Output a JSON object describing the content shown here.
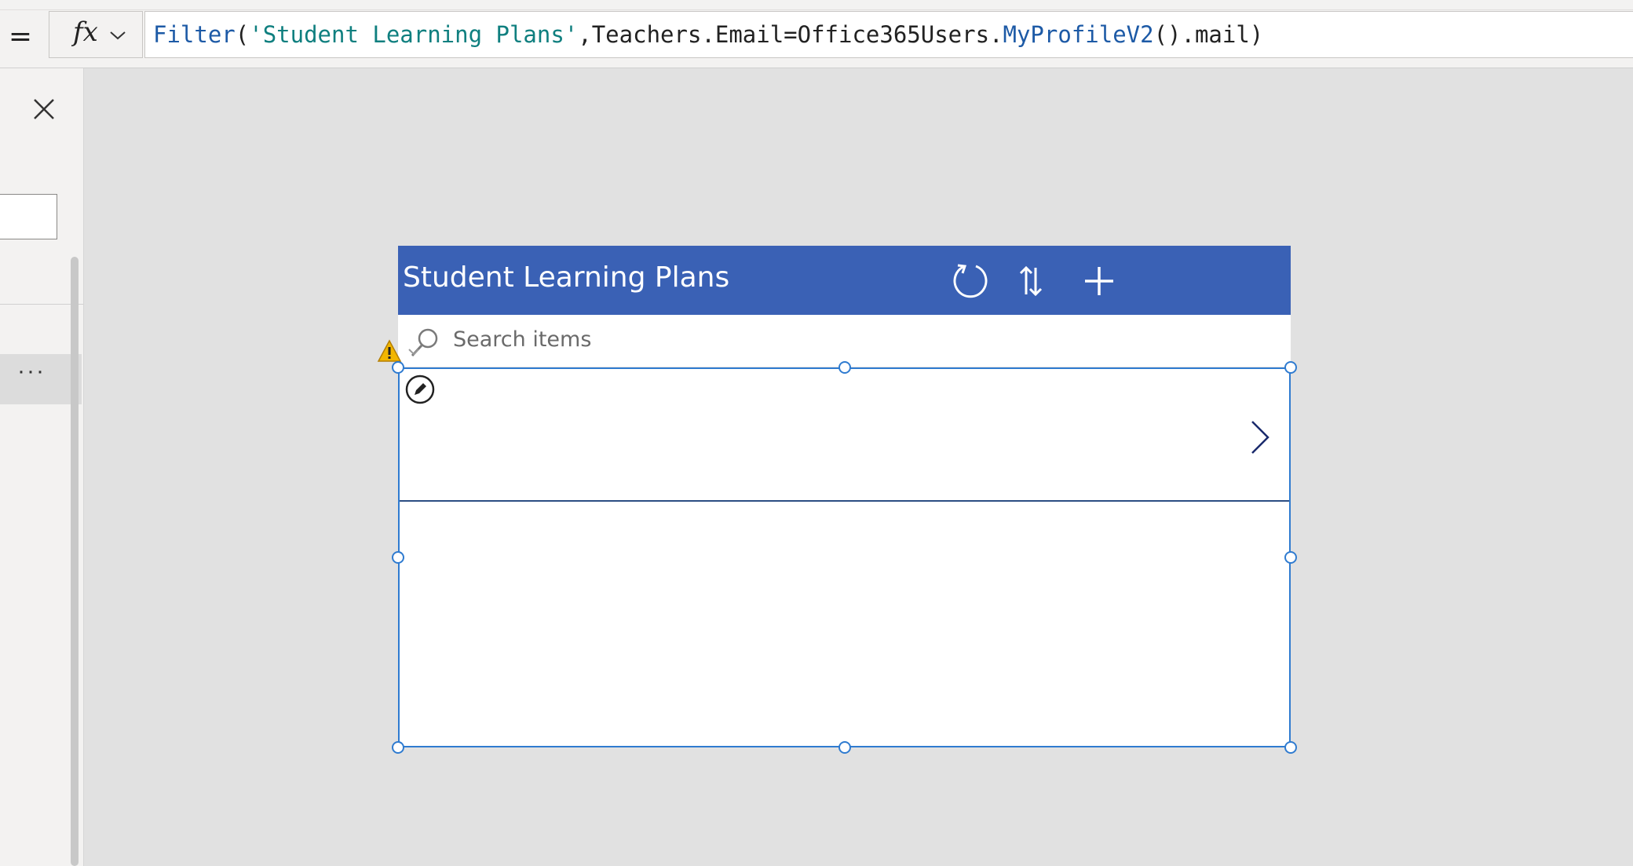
{
  "formula_bar": {
    "equals_symbol": "=",
    "fx_label": "fx",
    "tokens": [
      {
        "text": "Filter",
        "kind": "fn"
      },
      {
        "text": "(",
        "kind": "plain"
      },
      {
        "text": "'Student Learning Plans'",
        "kind": "str"
      },
      {
        "text": ",Teachers.Email=Office365Users.",
        "kind": "plain"
      },
      {
        "text": "MyProfileV2",
        "kind": "fn"
      },
      {
        "text": "().mail)",
        "kind": "plain"
      }
    ]
  },
  "left_panel": {
    "close_icon": "close-icon",
    "more_label": "···"
  },
  "app": {
    "title": "Student Learning Plans",
    "header_icons": [
      "refresh-icon",
      "sort-icon",
      "add-icon"
    ],
    "search": {
      "placeholder": "Search items",
      "icon": "search-icon"
    },
    "gallery": {
      "row_icons": [
        "edit-icon",
        "chevron-right-icon"
      ]
    }
  },
  "colors": {
    "header_bg": "#3a61b5",
    "selection_border": "#2f7bd0",
    "function_token": "#1d5aa6",
    "string_token": "#0f7f7f",
    "warning": "#f2b600"
  }
}
